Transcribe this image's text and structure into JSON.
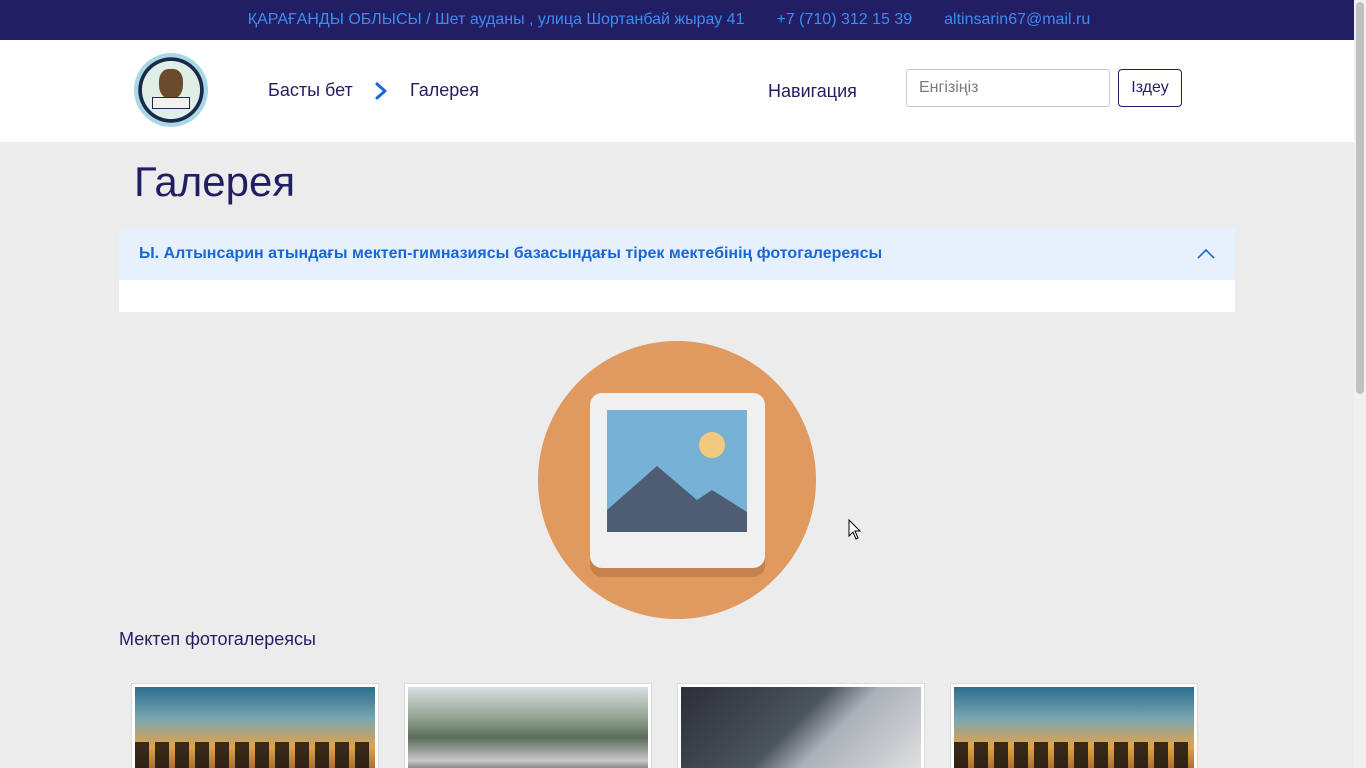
{
  "topbar": {
    "address": "ҚАРАҒАНДЫ ОБЛЫСЫ / Шет ауданы , улица Шортанбай жырау 41",
    "phone": "+7 (710) 312 15 39",
    "email": "altinsarin67@mail.ru"
  },
  "header": {
    "breadcrumb_home": "Басты бет",
    "breadcrumb_current": "Галерея",
    "nav_label": "Навигация",
    "search_placeholder": "Енгізіңіз",
    "search_button": "Іздеу"
  },
  "page": {
    "title": "Галерея",
    "accordion_title": "Ы. Алтынсарин атындағы мектеп-гимназиясы базасындағы тірек мектебінің фотогалереясы",
    "section_title": "Мектеп фотогалереясы"
  },
  "gallery": [
    {
      "icon": "sunset-crowd-photo"
    },
    {
      "icon": "race-car-photo"
    },
    {
      "icon": "car-headlight-photo"
    },
    {
      "icon": "sunset-crowd-photo"
    }
  ],
  "colors": {
    "topbar_bg": "#221e64",
    "topbar_text": "#3c8cf4",
    "accent": "#1a66d6",
    "page_bg": "#ececec"
  }
}
